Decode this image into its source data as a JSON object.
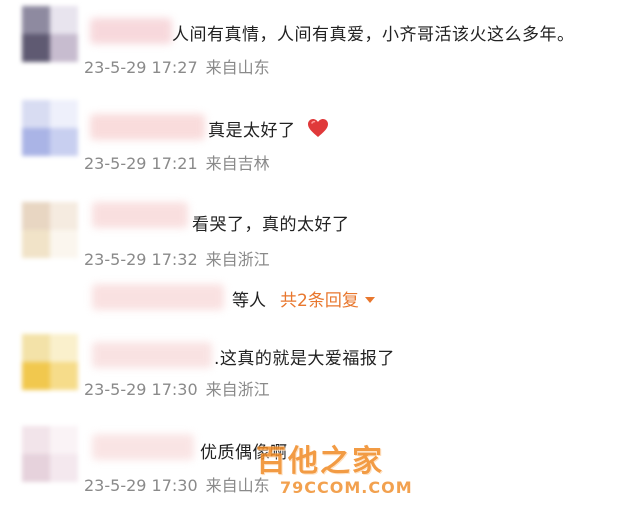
{
  "comments": [
    {
      "text": "人间有真情，人间有真爱，小齐哥活该火这么多年。",
      "date": "23-5-29 17:27",
      "location": "来自山东"
    },
    {
      "text": "真是太好了",
      "emoji": "heart-icon",
      "date": "23-5-29 17:21",
      "location": "来自吉林"
    },
    {
      "text": "看哭了，真的太好了",
      "date": "23-5-29 17:32",
      "location": "来自浙江"
    },
    {
      "text": ".这真的就是大爱福报了",
      "date": "23-5-29 17:30",
      "location": "来自浙江"
    },
    {
      "text": "优质偶像啊",
      "date": "23-5-29 17:30",
      "location": "来自山东"
    }
  ],
  "replies": {
    "suffix": "等人",
    "more_label": "共2条回复"
  },
  "watermark": {
    "main": "百他之家",
    "sub": "79CCOM.COM"
  },
  "colors": {
    "accent": "#e8772e",
    "meta": "#8a8a8a",
    "text": "#222222",
    "heart": "#e0393a"
  }
}
